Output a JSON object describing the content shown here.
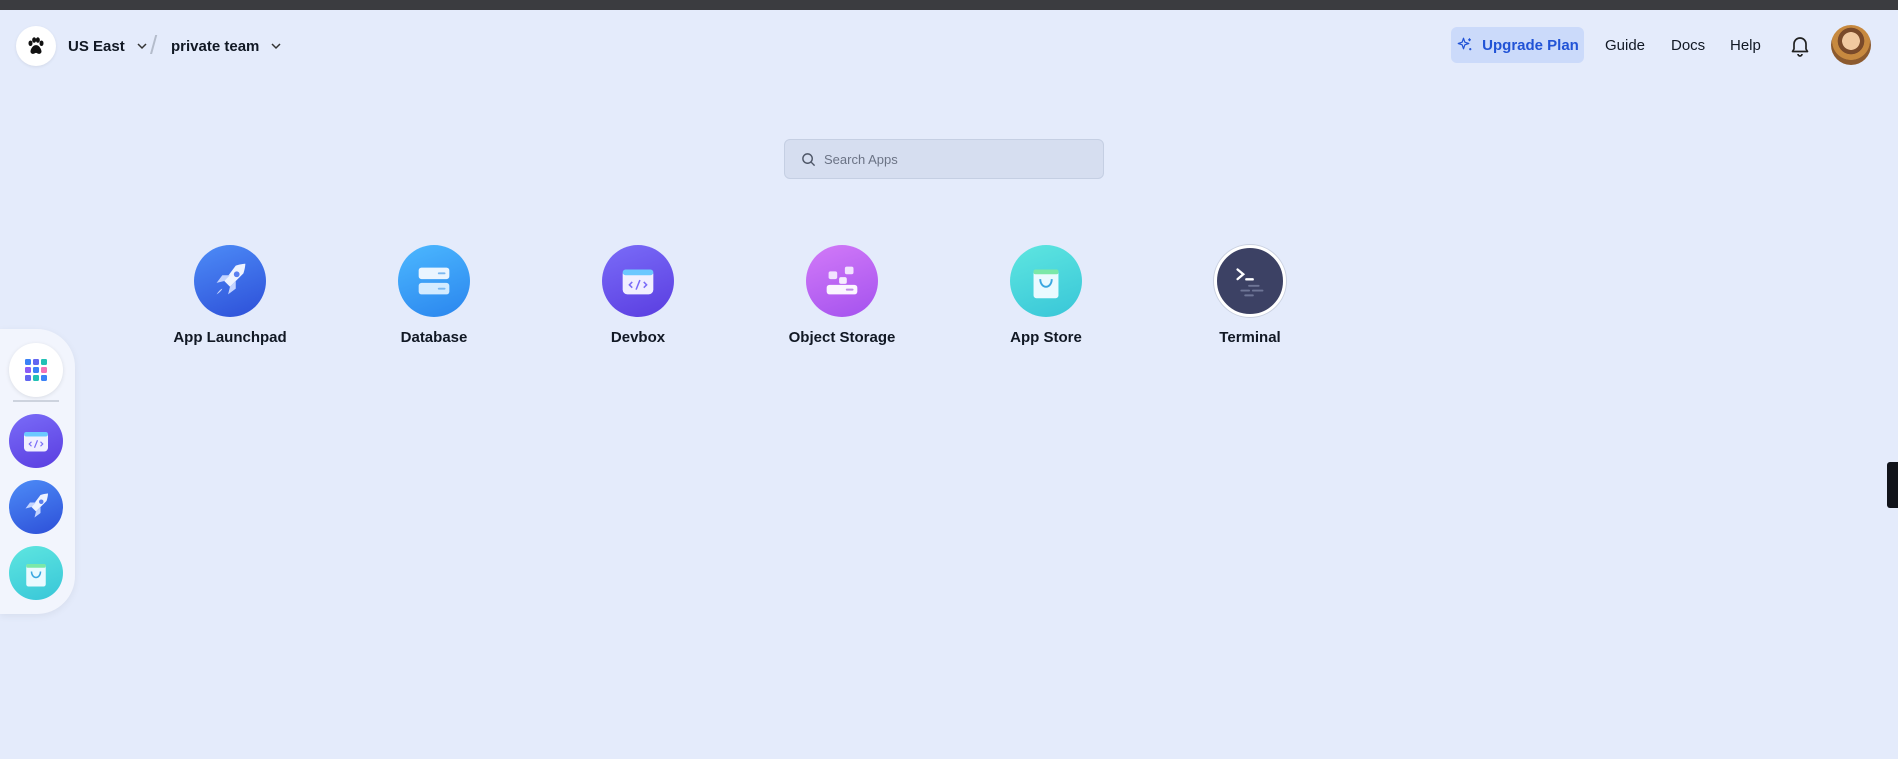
{
  "header": {
    "region": "US East",
    "team": "private team",
    "upgrade_label": "Upgrade Plan",
    "nav": [
      "Guide",
      "Docs",
      "Help"
    ]
  },
  "search": {
    "placeholder": "Search Apps"
  },
  "apps": [
    {
      "label": "App Launchpad",
      "icon": "rocket-icon"
    },
    {
      "label": "Database",
      "icon": "database-icon"
    },
    {
      "label": "Devbox",
      "icon": "code-window-icon"
    },
    {
      "label": "Object Storage",
      "icon": "storage-blocks-icon"
    },
    {
      "label": "App Store",
      "icon": "shopping-bag-icon"
    },
    {
      "label": "Terminal",
      "icon": "terminal-icon"
    }
  ],
  "dock": [
    "app-grid-icon",
    "code-window-icon",
    "rocket-icon",
    "shopping-bag-icon"
  ],
  "colors": {
    "accent": "#2153d6",
    "background": "#e4ebfb",
    "upgrade_bg": "#cbdafa"
  }
}
